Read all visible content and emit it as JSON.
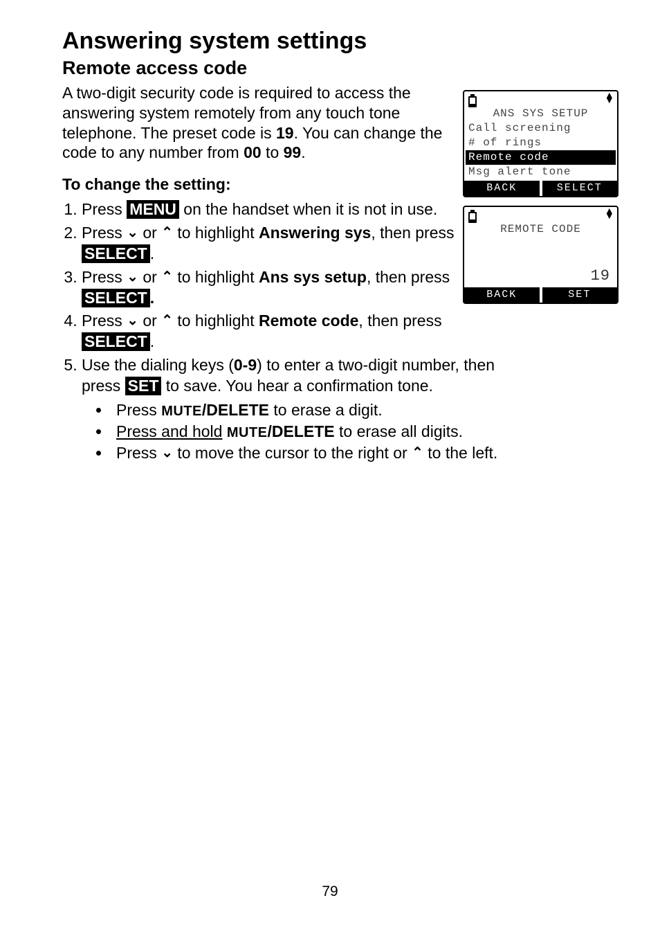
{
  "page_number": "79",
  "heading": "Answering system settings",
  "subheading": "Remote access code",
  "intro": {
    "part1": "A two-digit security code is required to access the answering system remotely from any touch tone telephone. The preset code is ",
    "preset_code": "19",
    "part2": ". You can change the code to any number from ",
    "min": "00",
    "part3": " to ",
    "max": "99",
    "part4": "."
  },
  "steps_heading": "To change the setting:",
  "buttons": {
    "menu": "MENU",
    "select": "SELECT",
    "set": "SET"
  },
  "labels": {
    "answering_sys": "Answering sys",
    "ans_sys_setup": "Ans sys setup",
    "remote_code": "Remote code",
    "mute_delete": "/DELETE",
    "mute_small": "MUTE",
    "press_and_hold": "Press and hold"
  },
  "steps": {
    "s1a": "Press ",
    "s1b": " on the handset when it is not in use.",
    "s2a": "Press ",
    "s2b": " or ",
    "s2c": " to highlight ",
    "s2d": ", then press ",
    "s2e": ".",
    "s3a": "Press ",
    "s3b": " or ",
    "s3c": " to highlight ",
    "s3d": ", then press ",
    "s3e": ".",
    "s4a": "Press ",
    "s4b": " or ",
    "s4c": " to highlight ",
    "s4d": ", then press ",
    "s4e": ".",
    "s5a": "Use the dialing keys (",
    "s5range": "0-9",
    "s5b": ") to enter a two-digit number, then press ",
    "s5c": " to save. You hear a confirmation tone."
  },
  "bullets": {
    "b1a": "Press ",
    "b1b": " to erase a digit.",
    "b2a": " ",
    "b2b": " to erase all digits.",
    "b3a": "Press ",
    "b3b": " to move the cursor to the right or ",
    "b3c": " to the left."
  },
  "screen1": {
    "title": "ANS SYS SETUP",
    "line1": "Call screening",
    "line2": "# of rings",
    "highlight": "Remote code",
    "line3": "Msg alert tone",
    "soft_left": "BACK",
    "soft_right": "SELECT"
  },
  "screen2": {
    "title": "REMOTE CODE",
    "value": "19",
    "soft_left": "BACK",
    "soft_right": "SET"
  }
}
